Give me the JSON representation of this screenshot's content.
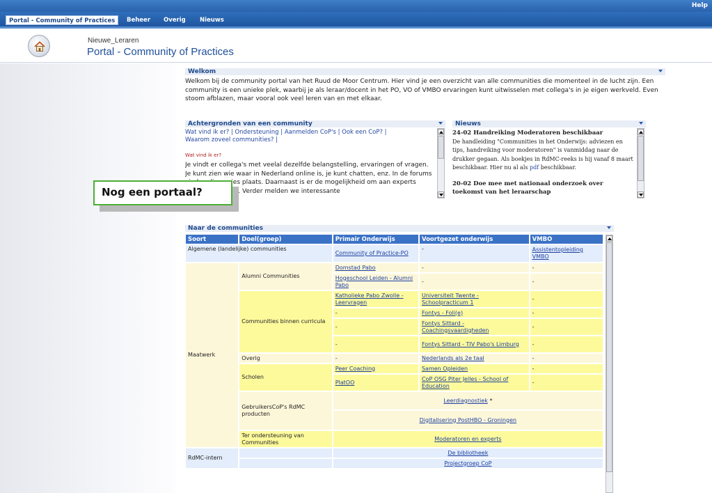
{
  "topbar": {
    "help": "Help"
  },
  "nav": {
    "tabs": [
      "Portal - Community of Practices",
      "Beheer",
      "Overig",
      "Nieuws"
    ]
  },
  "header": {
    "subtitle": "Nieuwe_Leraren",
    "title": "Portal - Community of Practices"
  },
  "welcome": {
    "title": "Welkom",
    "text": "Welkom bij de community portal van het Ruud de Moor Centrum. Hier vind  je een overzicht van alle communities die momenteel in de lucht zijn. Een community is een unieke plek, waarbij je als leraar/docent in het PO, VO of VMBO ervaringen kunt uitwisselen met collega's in je eigen werkveld. Even stoom afblazen, maar vooral ook veel leren van en met elkaar."
  },
  "background": {
    "title": "Achtergronden van een community",
    "links_line1": "Wat vind ik er? | Ondersteuning | Aanmelden CoP's | Ook een CoP? |",
    "links_line2": "Waarom zoveel communities? |",
    "section_label": "Wat vind ik er?",
    "body": "Je vindt er collega's met veelal dezelfde belangstelling, ervaringen of vragen. Je kunt zien wie waar in Nederland online is, je kunt chatten, enz.  In de forums vinden discussies plaats. Daarnaast is er de mogelijkheid om aan experts vragen te stellen. Verder melden we interessante"
  },
  "news": {
    "title": "Nieuws",
    "item1_title": "24-02 Handreiking Moderatoren beschikbaar",
    "item1_body_a": "De handleiding \"Communities in het Onderwijs: adviezen en tips, handreiking voor moderatoren\" is vanmiddag naar de drukker gegaan. Als boekjes in RdMC-reeks is hij vanaf 8 maart beschikbaar. Hier nu al als ",
    "item1_link": "pdf",
    "item1_body_b": " beschikbaar.",
    "item2_title": "20-02 Doe mee met nationaal onderzoek over toekomst van het leraarschap"
  },
  "callout": {
    "text": "Nog een portaal?"
  },
  "communities": {
    "title": "Naar de communities",
    "headers": [
      "Soort",
      "Doel(groep)",
      "Primair Onderwijs",
      "Voortgezet onderwijs",
      "VMBO"
    ],
    "row_alg": {
      "label": "Algemene (landelijke) communities",
      "po": "Community of Practice-PO",
      "vo": "-",
      "vmbo": "Assistentopleiding VMBO"
    },
    "maatwerk_label": "Maatwerk",
    "alumni_label": "Alumni Communities",
    "alumni_rows": [
      {
        "po": "Domstad Pabo",
        "vo": "-",
        "vmbo": "-"
      },
      {
        "po": "Hogeschool Leiden - Alumni Pabo",
        "vo": "-",
        "vmbo": "-"
      }
    ],
    "curricula_label": "Communities binnen curricula",
    "curricula_rows": [
      {
        "po": "Katholieke Pabo Zwolle - Leervragen",
        "vo": "Universiteit Twente - Schoolpracticum 1",
        "vmbo": "-"
      },
      {
        "po": "-",
        "vo": "Fontys - Foli(e)",
        "vmbo": "-"
      },
      {
        "po": "-",
        "vo": "Fontys Sittard - Coachingsvaardigheden",
        "vmbo": "-"
      },
      {
        "po": "-",
        "vo": "Fontys Sittard - TIV Pabo's Limburg",
        "vmbo": "-"
      }
    ],
    "overig": {
      "label": "Overig",
      "po": "-",
      "vo": "Nederlands als 2e taal",
      "vmbo": "-"
    },
    "scholen_label": "Scholen",
    "scholen_rows": [
      {
        "po": "Peer Coaching",
        "vo": "Samen Opleiden",
        "vmbo": "-"
      },
      {
        "po": "PlatOO",
        "vo": "CoP OSG Piter Jelles - School of Education",
        "vmbo": "-"
      }
    ],
    "gebruikers_label": "GebruikersCoP's RdMC producten",
    "gebruikers_rows": [
      "Leerdiagnostiek",
      "Digitalisering PostHBO - Groningen"
    ],
    "gebruikers_star": "*",
    "ter_label": "Ter ondersteuning van Communities",
    "ter_value": "Moderatoren en experts",
    "rdmc_label": "RdMC-intern",
    "rdmc_rows": [
      "De bibliotheek",
      "Projectgroep CoP"
    ]
  },
  "colors": {
    "nav_blue": "#2a62ad",
    "table_header": "#3a72c6",
    "callout_border": "#4cae35"
  }
}
